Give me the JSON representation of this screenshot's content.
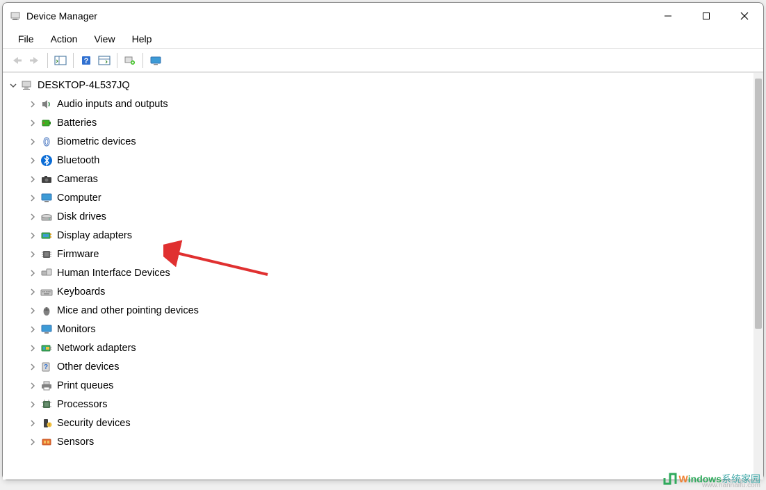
{
  "title": "Device Manager",
  "menu": [
    "File",
    "Action",
    "View",
    "Help"
  ],
  "tree": {
    "root": {
      "label": "DESKTOP-4L537JQ",
      "expanded": true,
      "icon": "computer-icon"
    },
    "children": [
      {
        "label": "Audio inputs and outputs",
        "icon": "speaker-icon"
      },
      {
        "label": "Batteries",
        "icon": "battery-icon"
      },
      {
        "label": "Biometric devices",
        "icon": "fingerprint-icon"
      },
      {
        "label": "Bluetooth",
        "icon": "bluetooth-icon"
      },
      {
        "label": "Cameras",
        "icon": "camera-icon"
      },
      {
        "label": "Computer",
        "icon": "monitor-icon"
      },
      {
        "label": "Disk drives",
        "icon": "disk-icon"
      },
      {
        "label": "Display adapters",
        "icon": "display-adapter-icon"
      },
      {
        "label": "Firmware",
        "icon": "chip-icon"
      },
      {
        "label": "Human Interface Devices",
        "icon": "hid-icon"
      },
      {
        "label": "Keyboards",
        "icon": "keyboard-icon"
      },
      {
        "label": "Mice and other pointing devices",
        "icon": "mouse-icon"
      },
      {
        "label": "Monitors",
        "icon": "monitor-icon"
      },
      {
        "label": "Network adapters",
        "icon": "network-icon"
      },
      {
        "label": "Other devices",
        "icon": "unknown-device-icon"
      },
      {
        "label": "Print queues",
        "icon": "printer-icon"
      },
      {
        "label": "Processors",
        "icon": "cpu-icon"
      },
      {
        "label": "Security devices",
        "icon": "security-icon"
      },
      {
        "label": "Sensors",
        "icon": "sensor-icon"
      }
    ]
  },
  "watermark": {
    "brand": "indows",
    "cn": "系统家园",
    "url": "www.nannaifu.com"
  }
}
